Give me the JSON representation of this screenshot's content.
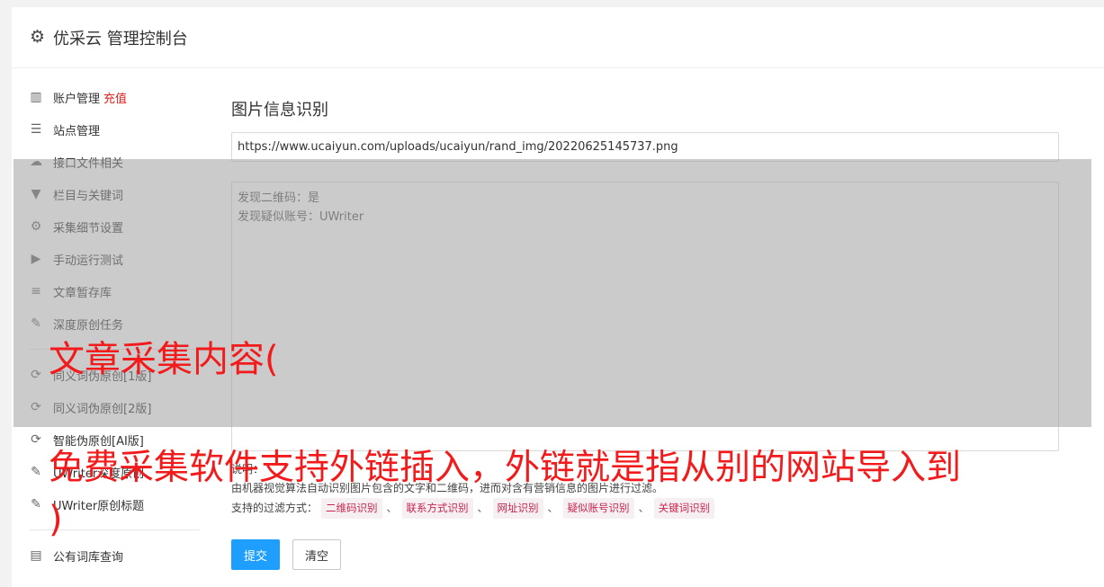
{
  "header": {
    "title": "优采云 管理控制台",
    "icon": "gear-icon"
  },
  "sidebar": {
    "group1": [
      {
        "icon": "bar-chart-icon",
        "glyph": "▥",
        "label": "账户管理",
        "badge": "充值"
      },
      {
        "icon": "server-icon",
        "glyph": "☰",
        "label": "站点管理"
      },
      {
        "icon": "cloud-upload-icon",
        "glyph": "☁",
        "label": "接口文件相关"
      },
      {
        "icon": "filter-icon",
        "glyph": "▼",
        "label": "栏目与关键词"
      },
      {
        "icon": "gears-icon",
        "glyph": "⚙",
        "label": "采集细节设置"
      },
      {
        "icon": "play-circle-icon",
        "glyph": "▶",
        "label": "手动运行测试"
      },
      {
        "icon": "database-icon",
        "glyph": "≡",
        "label": "文章暂存库"
      },
      {
        "icon": "edit-icon",
        "glyph": "✎",
        "label": "深度原创任务"
      }
    ],
    "group2": [
      {
        "icon": "refresh-icon",
        "glyph": "⟳",
        "label": "同义词伪原创[1版]"
      },
      {
        "icon": "refresh-icon",
        "glyph": "⟳",
        "label": "同义词伪原创[2版]"
      },
      {
        "icon": "refresh-icon",
        "glyph": "⟳",
        "label": "智能伪原创[AI版]"
      },
      {
        "icon": "edit-icon",
        "glyph": "✎",
        "label": "UWriter深度原创"
      },
      {
        "icon": "edit-icon",
        "glyph": "✎",
        "label": "UWriter原创标题"
      }
    ],
    "group3": [
      {
        "icon": "book-icon",
        "glyph": "▤",
        "label": "公有词库查询"
      }
    ]
  },
  "main": {
    "title": "图片信息识别",
    "url_value": "https://www.ucaiyun.com/uploads/ucaiyun/rand_img/20220625145737.png",
    "result_lines": [
      "发现二维码：是",
      "发现疑似账号：UWriter"
    ],
    "desc_label": "说明：",
    "desc_text": "由机器视觉算法自动识别图片包含的文字和二维码，进而对含有营销信息的图片进行过滤。",
    "filter_label": "支持的过滤方式：",
    "filters": [
      "二维码识别",
      "联系方式识别",
      "网址识别",
      "疑似账号识别",
      "关键词识别"
    ],
    "separator": "、",
    "submit_label": "提交",
    "clear_label": "清空"
  },
  "overlay": {
    "line1": "文章采集内容(",
    "line2": "免费采集软件支持外链插入，外链就是指从别的网站导入到",
    "line3": ")"
  }
}
